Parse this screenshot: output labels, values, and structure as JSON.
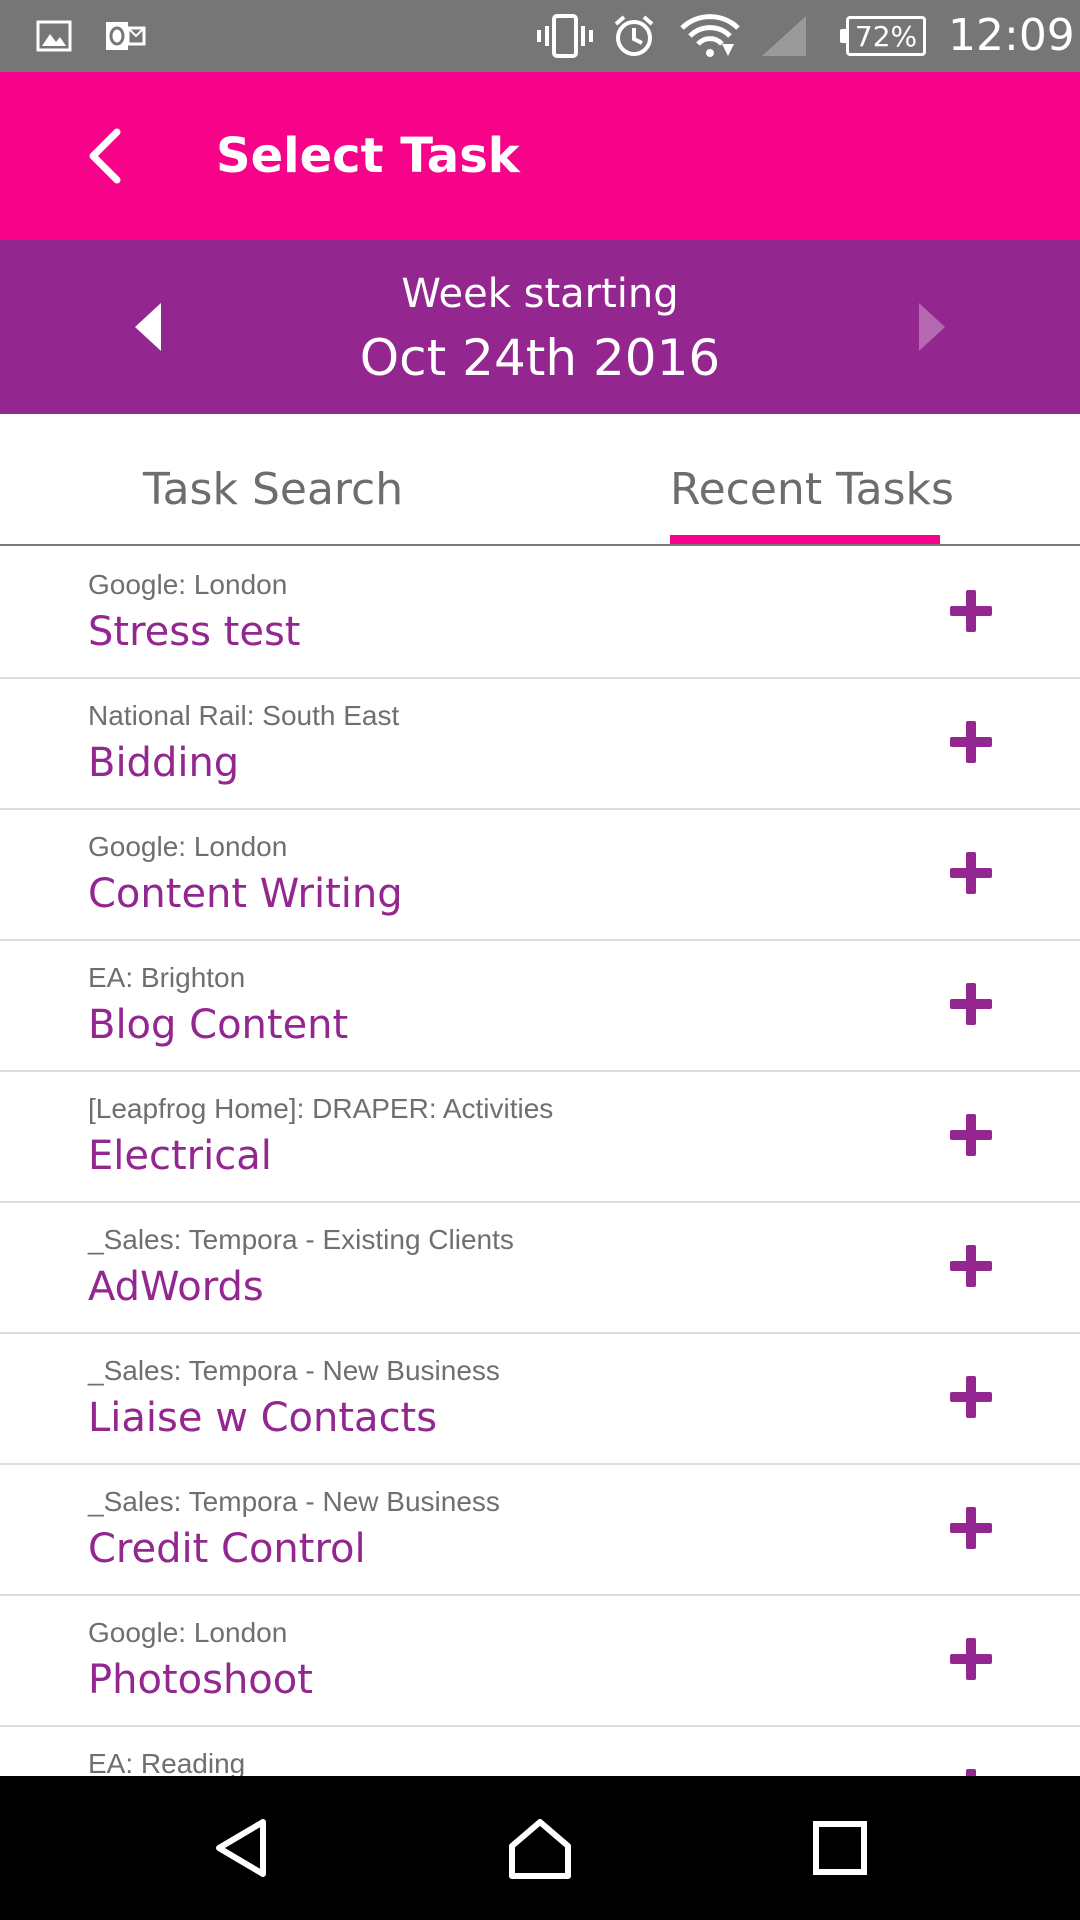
{
  "status_bar": {
    "battery_text": "72%",
    "battery_level": 72,
    "clock": "12:09",
    "icons": [
      "gallery-icon",
      "outlook-icon",
      "vibrate-icon",
      "alarm-icon",
      "wifi-icon",
      "signal-icon"
    ]
  },
  "header": {
    "title": "Select Task"
  },
  "week": {
    "label": "Week starting",
    "date": "Oct 24th 2016"
  },
  "tabs": [
    {
      "label": "Task Search",
      "active": false
    },
    {
      "label": "Recent Tasks",
      "active": true
    }
  ],
  "tasks": [
    {
      "client": "Google: London",
      "name": "Stress test"
    },
    {
      "client": "National Rail: South East",
      "name": "Bidding"
    },
    {
      "client": "Google: London",
      "name": "Content Writing"
    },
    {
      "client": "EA: Brighton",
      "name": "Blog Content"
    },
    {
      "client": "[Leapfrog Home]: DRAPER: Activities",
      "name": "Electrical"
    },
    {
      "client": "_Sales: Tempora - Existing Clients",
      "name": "AdWords"
    },
    {
      "client": "_Sales: Tempora - New Business",
      "name": "Liaise w Contacts"
    },
    {
      "client": "_Sales: Tempora - New Business",
      "name": "Credit Control"
    },
    {
      "client": "Google: London",
      "name": "Photoshoot"
    },
    {
      "client": "EA: Reading",
      "name": ""
    }
  ],
  "colors": {
    "status_bar": "#767676",
    "app_bar": "#f7038a",
    "week_bar": "#93268f",
    "accent": "#f7038a",
    "task_name": "#93268f",
    "nav_bar": "#000000"
  }
}
